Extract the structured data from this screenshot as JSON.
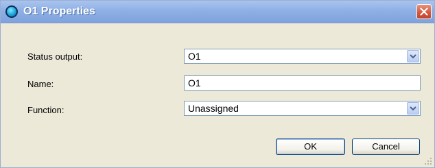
{
  "window": {
    "title": "O1 Properties",
    "title_icon": "status-output-icon",
    "close_icon": "close-icon"
  },
  "form": {
    "status_output": {
      "label": "Status output:",
      "value": "O1"
    },
    "name": {
      "label": "Name:",
      "value": "O1"
    },
    "function": {
      "label": "Function:",
      "value": "Unassigned"
    }
  },
  "buttons": {
    "ok": "OK",
    "cancel": "Cancel"
  },
  "colors": {
    "titlebar": "#8fb0e6",
    "dialog_bg": "#ece9d8",
    "close_button": "#d4553a",
    "field_border": "#7f9db9"
  }
}
